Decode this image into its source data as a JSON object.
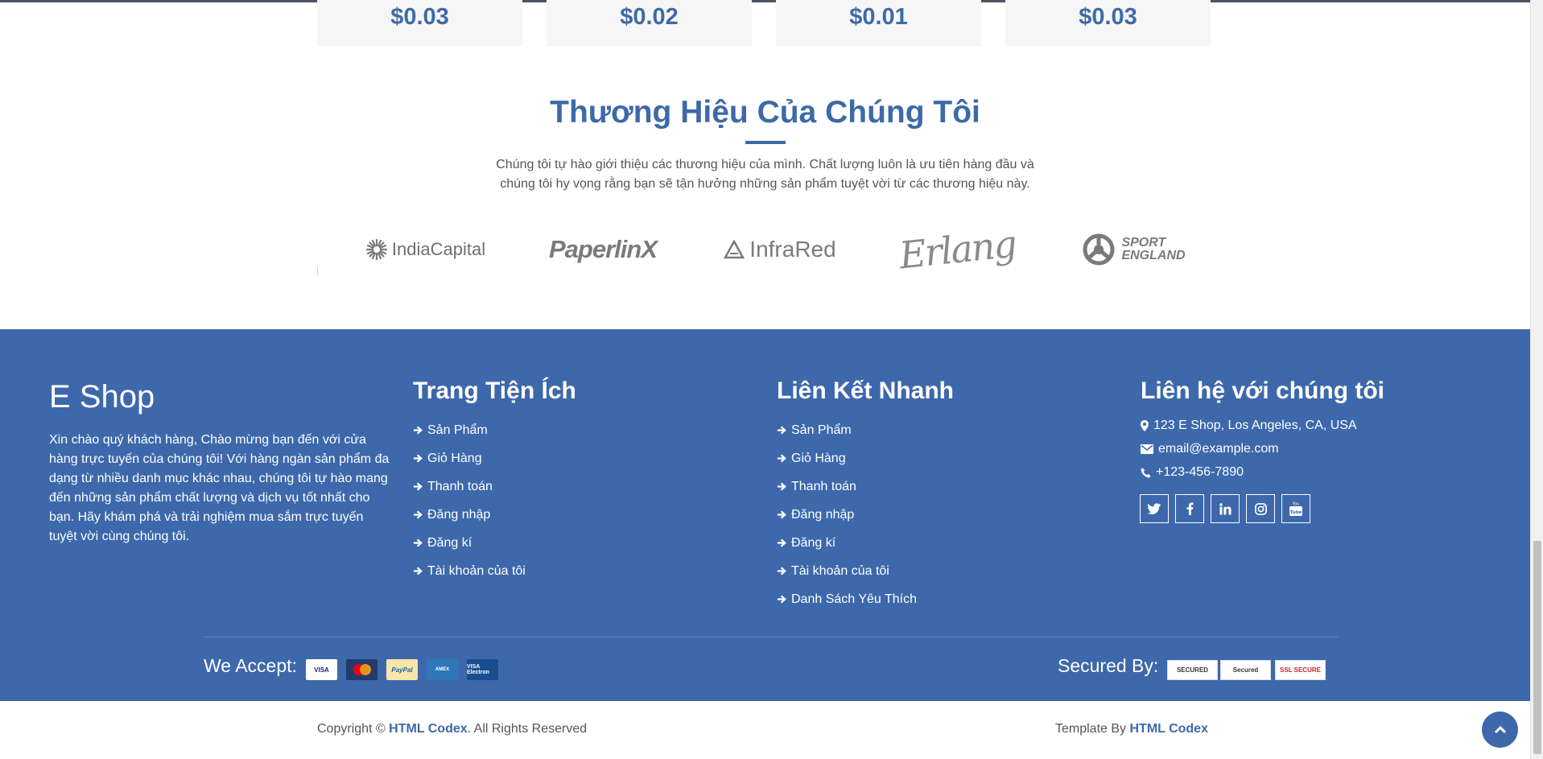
{
  "prices": [
    "$0.03",
    "$0.02",
    "$0.01",
    "$0.03"
  ],
  "brands": {
    "title": "Thương Hiệu Của Chúng Tôi",
    "description": "Chúng tôi tự hào giới thiệu các thương hiệu của mình. Chất lượng luôn là ưu tiên hàng đầu và chúng tôi hy vọng rằng bạn sẽ tận hưởng những sản phẩm tuyệt vời từ các thương hiệu này.",
    "logos": [
      "IndiaCapital",
      "PaperlinX",
      "InfraRed",
      "Erlang",
      "SPORT",
      "ENGLAND"
    ]
  },
  "footer": {
    "brand": "E Shop",
    "about": "Xin chào quý khách hàng, Chào mừng bạn đến với cửa hàng trực tuyến của chúng tôi! Với hàng ngàn sản phẩm đa dạng từ nhiều danh mục khác nhau, chúng tôi tự hào mang đến những sản phẩm chất lượng và dịch vụ tốt nhất cho bạn. Hãy khám phá và trải nghiệm mua sắm trực tuyến tuyệt vời cùng chúng tôi.",
    "utility": {
      "heading": "Trang Tiện Ích",
      "items": [
        "Sản Phẩm",
        "Giỏ Hàng",
        "Thanh toán",
        "Đăng nhập",
        "Đăng kí",
        "Tài khoản của tôi"
      ]
    },
    "quick": {
      "heading": "Liên Kết Nhanh",
      "items": [
        "Sản Phẩm",
        "Giỏ Hàng",
        "Thanh toán",
        "Đăng nhập",
        "Đăng kí",
        "Tài khoản của tôi",
        "Danh Sách Yêu Thích"
      ]
    },
    "contact": {
      "heading": "Liên hệ với chúng tôi",
      "address": "123 E Shop, Los Angeles, CA, USA",
      "email": "email@example.com",
      "phone": "+123-456-7890"
    },
    "social_icons": [
      "twitter-icon",
      "facebook-icon",
      "linkedin-icon",
      "instagram-icon",
      "youtube-icon"
    ],
    "accept_label": "We Accept:",
    "payment_cards": [
      "VISA",
      "MasterCard",
      "PayPal",
      "AMERICAN EXPRESS",
      "VISA Electron"
    ],
    "secured_label": "Secured By:",
    "security_badges": [
      "SECURED",
      "Secured",
      "SSL SECURE"
    ]
  },
  "bottom": {
    "copyright_prefix": "Copyright © ",
    "copyright_link": "HTML Codex",
    "copyright_suffix": ". All Rights Reserved",
    "template_prefix": "Template By ",
    "template_link": "HTML Codex"
  },
  "colors": {
    "primary": "#3d68ab",
    "title": "#3d6aa7",
    "card_bg": "#f6f6f6"
  }
}
